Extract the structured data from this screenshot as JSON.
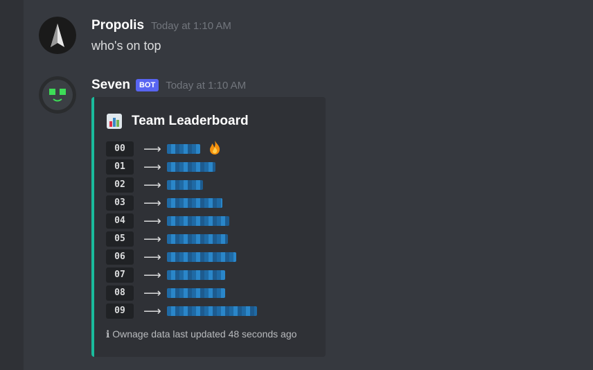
{
  "messages": [
    {
      "username": "Propolis",
      "timestamp": "Today at 1:10 AM",
      "content": "who's on top"
    },
    {
      "username": "Seven",
      "badge": "BOT",
      "timestamp": "Today at 1:10 AM"
    }
  ],
  "embed": {
    "accent_color": "#1abc9c",
    "title_icon": "bar-chart-icon",
    "title": "Team Leaderboard",
    "rows": [
      {
        "rank": "00",
        "arrow": "⟶",
        "badge_icon": "fire-icon"
      },
      {
        "rank": "01",
        "arrow": "⟶"
      },
      {
        "rank": "02",
        "arrow": "⟶"
      },
      {
        "rank": "03",
        "arrow": "⟶"
      },
      {
        "rank": "04",
        "arrow": "⟶"
      },
      {
        "rank": "05",
        "arrow": "⟶"
      },
      {
        "rank": "06",
        "arrow": "⟶"
      },
      {
        "rank": "07",
        "arrow": "⟶"
      },
      {
        "rank": "08",
        "arrow": "⟶"
      },
      {
        "rank": "09",
        "arrow": "⟶"
      }
    ],
    "footer_icon": "info-icon",
    "footer_text": "Ownage data last updated 48 seconds ago"
  }
}
